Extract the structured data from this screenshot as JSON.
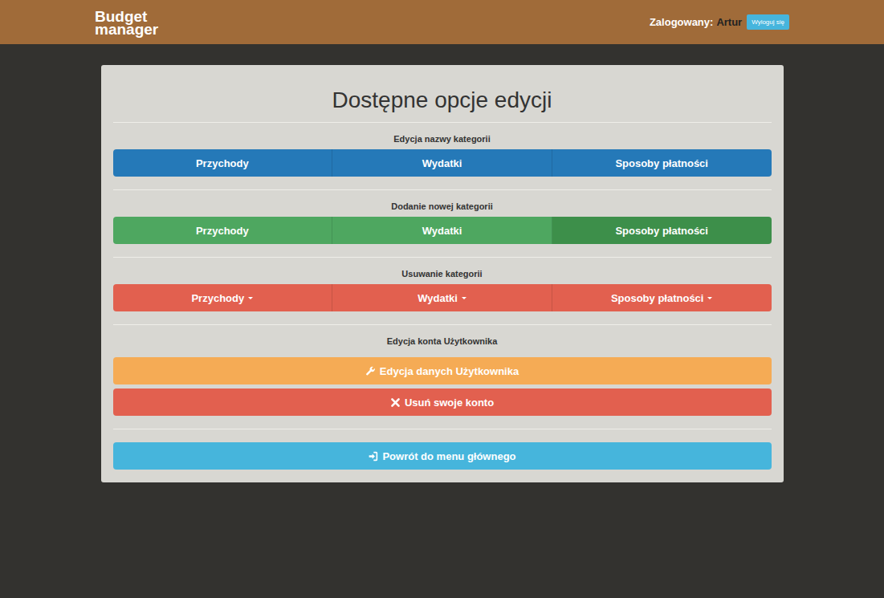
{
  "header": {
    "logo": [
      "Budget",
      "manager"
    ],
    "logged_label": "Zalogowany:",
    "user": "Artur",
    "logout": "Wyloguj się"
  },
  "panel": {
    "title": "Dostępne opcje edycji"
  },
  "sections": [
    {
      "label": "Edycja nazwy kategorii",
      "kind": "edit",
      "buttons": [
        {
          "label": "Przychody",
          "dropdown": false,
          "hovered": false
        },
        {
          "label": "Wydatki",
          "dropdown": false,
          "hovered": false
        },
        {
          "label": "Sposoby płatności",
          "dropdown": false,
          "hovered": false
        }
      ]
    },
    {
      "label": "Dodanie nowej kategorii",
      "kind": "add",
      "buttons": [
        {
          "label": "Przychody",
          "dropdown": false,
          "hovered": false
        },
        {
          "label": "Wydatki",
          "dropdown": false,
          "hovered": false
        },
        {
          "label": "Sposoby płatności",
          "dropdown": false,
          "hovered": true
        }
      ]
    },
    {
      "label": "Usuwanie kategorii",
      "kind": "delete",
      "buttons": [
        {
          "label": "Przychody",
          "dropdown": true,
          "hovered": false
        },
        {
          "label": "Wydatki",
          "dropdown": true,
          "hovered": false
        },
        {
          "label": "Sposoby płatności",
          "dropdown": true,
          "hovered": false
        }
      ]
    }
  ],
  "account": {
    "label": "Edycja konta Użytkownika",
    "buttons": [
      {
        "label": "Edycja danych Użytkownika",
        "kind": "edit-account"
      },
      {
        "label": "Usuń swoje konto",
        "kind": "delete-account"
      }
    ]
  },
  "back": {
    "label": "Powrót do menu głównego"
  }
}
